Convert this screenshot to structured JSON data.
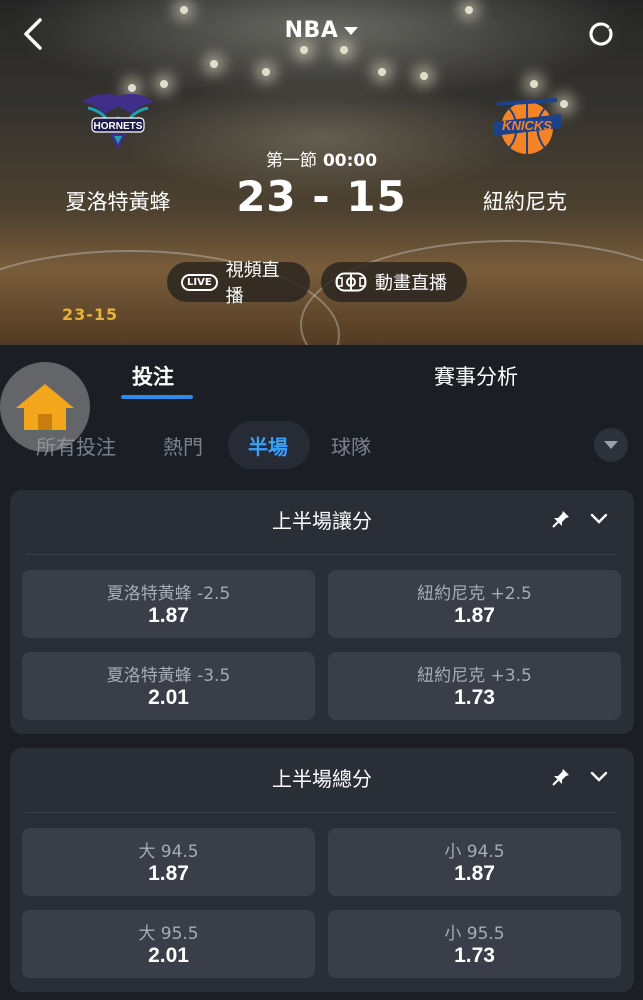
{
  "header": {
    "league": "NBA",
    "period": "第一節",
    "clock": "00:00",
    "score": "23 - 15",
    "home_team": "夏洛特黃蜂",
    "away_team": "紐約尼克",
    "home_logo_text": "HORNETS",
    "away_logo_text": "KNICKS",
    "live_video_badge": "LIVE",
    "live_video_label": "視頻直播",
    "animation_label": "動畫直播",
    "mini_score": "23-15"
  },
  "tabs": {
    "bet": "投注",
    "analysis": "賽事分析"
  },
  "sub_tabs": [
    "所有投注",
    "熱門",
    "半場",
    "球隊"
  ],
  "colors": {
    "accent": "#2b8cf0",
    "active_subtab": "#3aa0ff",
    "background": "#1b1e25",
    "card": "#2a2e37",
    "odd_button": "#3a3e48",
    "mini_score": "#e7b23a",
    "home_icon": "#f3a51c"
  },
  "markets": [
    {
      "title": "上半場讓分",
      "odds": [
        {
          "label": "夏洛特黃蜂 -2.5",
          "value": "1.87"
        },
        {
          "label": "紐約尼克 +2.5",
          "value": "1.87"
        },
        {
          "label": "夏洛特黃蜂 -3.5",
          "value": "2.01"
        },
        {
          "label": "紐約尼克 +3.5",
          "value": "1.73"
        }
      ]
    },
    {
      "title": "上半場總分",
      "odds": [
        {
          "label": "大 94.5",
          "value": "1.87"
        },
        {
          "label": "小 94.5",
          "value": "1.87"
        },
        {
          "label": "大 95.5",
          "value": "2.01"
        },
        {
          "label": "小 95.5",
          "value": "1.73"
        }
      ]
    }
  ]
}
